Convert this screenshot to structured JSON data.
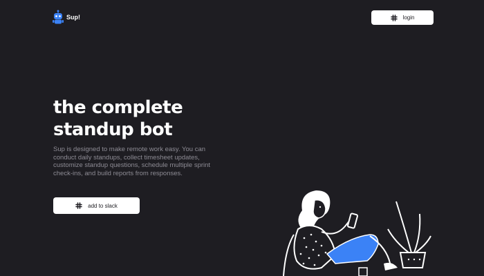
{
  "header": {
    "logo": {
      "text": "Sup!",
      "icon": "robot-icon"
    },
    "login": {
      "label": "login",
      "icon": "slack-icon"
    }
  },
  "hero": {
    "title_lines": [
      "the complete",
      "standup bot"
    ],
    "description": "Sup is designed to make remote work easy. You can conduct daily standups, collect timesheet updates, customize standup questions, schedule multiple sprint check-ins, and build reports from responses.",
    "cta": {
      "label": "add to slack",
      "icon": "slack-icon"
    }
  },
  "colors": {
    "background": "#1e1d22",
    "text": "#ffffff",
    "muted_text": "#8e8c95",
    "brand_blue": "#3b82f6",
    "button_bg": "#ffffff"
  }
}
